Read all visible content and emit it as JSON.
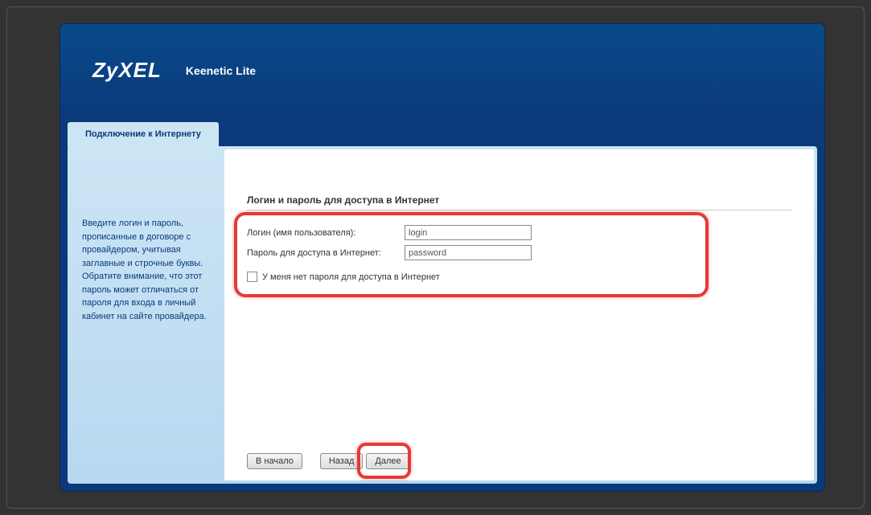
{
  "header": {
    "logo": "ZyXEL",
    "product": "Keenetic Lite"
  },
  "tab": {
    "label": "Подключение к Интернету"
  },
  "instructions": "Введите логин и пароль, прописанные в договоре с провайдером, учитывая заглавные и строчные буквы. Обратите внимание, что этот пароль может отличаться от пароля для входа в личный кабинет на сайте провайдера.",
  "section_title": "Логин и пароль для доступа в Интернет",
  "form": {
    "login_label": "Логин (имя пользователя):",
    "login_value": "login",
    "password_label": "Пароль для доступа в Интернет:",
    "password_value": "password",
    "no_password_label": "У меня нет пароля для доступа в Интернет"
  },
  "buttons": {
    "start": "В начало",
    "back": "Назад",
    "next": "Далее"
  }
}
